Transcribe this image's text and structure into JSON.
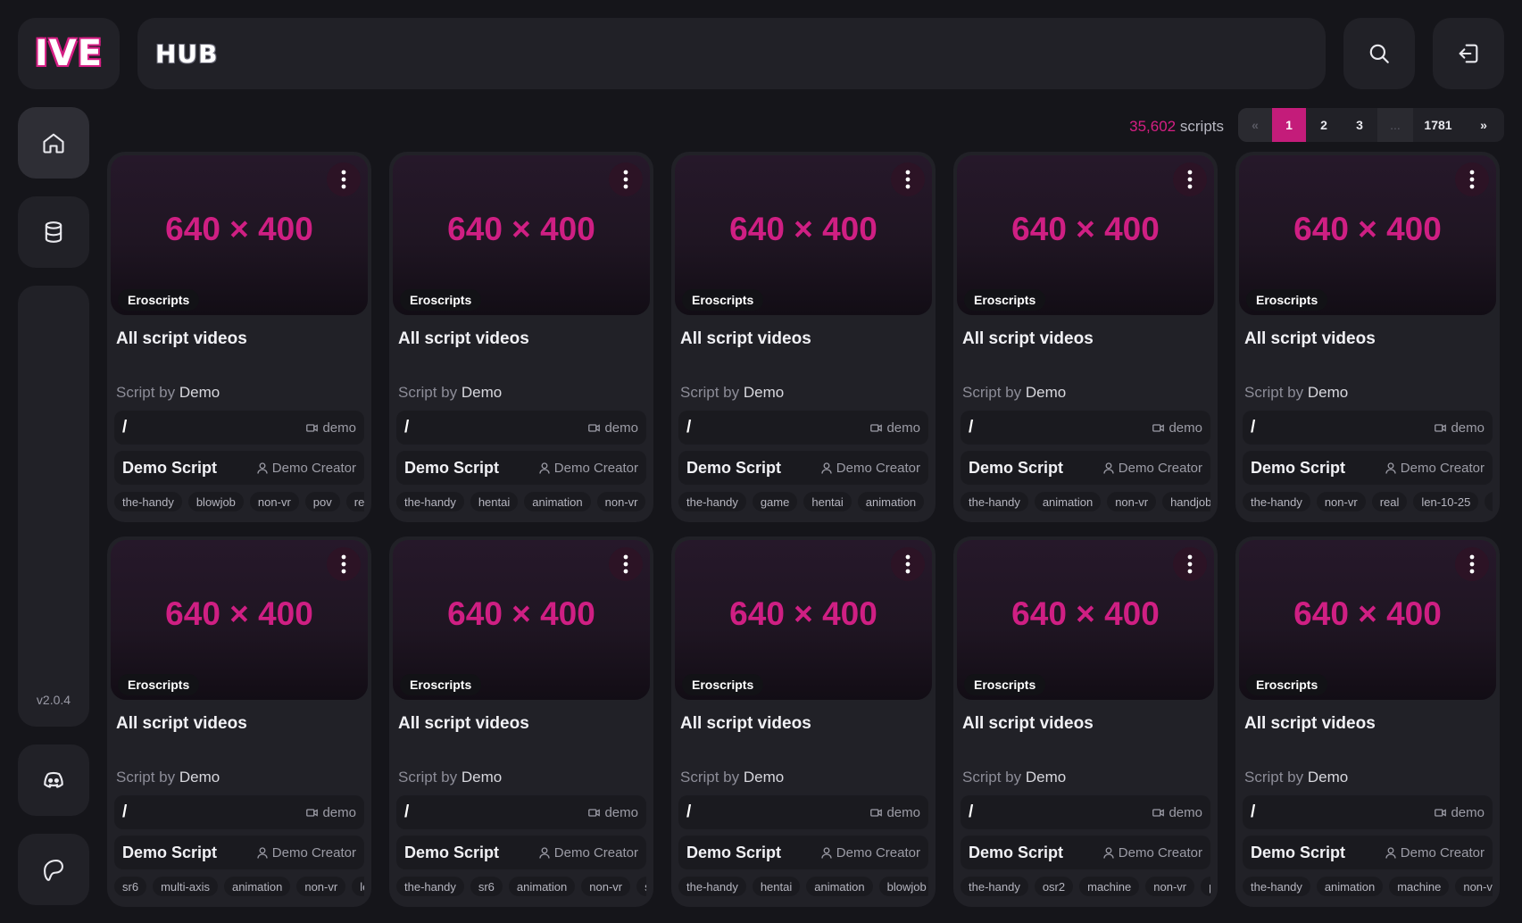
{
  "app": {
    "logo": "IVE",
    "title": "HUB",
    "version": "v2.0.4",
    "accent_color": "#d61f84"
  },
  "header": {
    "search_icon": "search-icon",
    "logout_icon": "logout-icon"
  },
  "sidebar": {
    "items": [
      {
        "name": "home",
        "icon": "home-icon",
        "active": true
      },
      {
        "name": "database",
        "icon": "database-icon",
        "active": false
      },
      {
        "name": "discord",
        "icon": "discord-icon",
        "active": false
      },
      {
        "name": "patreon",
        "icon": "patreon-icon",
        "active": false
      }
    ]
  },
  "results": {
    "count": "35,602",
    "count_label": "scripts"
  },
  "pagination": {
    "prev": "«",
    "pages": [
      "1",
      "2",
      "3"
    ],
    "ellipsis": "...",
    "last": "1781",
    "next": "»",
    "current": "1"
  },
  "cards": [
    {
      "thumb": "640 × 400",
      "source": "Eroscripts",
      "title": "All script videos",
      "script_by": "Script by",
      "author": "Demo",
      "path": "/",
      "video_user": "demo",
      "script_name": "Demo Script",
      "creator": "Demo Creator",
      "tags": [
        "the-handy",
        "blowjob",
        "non-vr",
        "pov",
        "re"
      ]
    },
    {
      "thumb": "640 × 400",
      "source": "Eroscripts",
      "title": "All script videos",
      "script_by": "Script by",
      "author": "Demo",
      "path": "/",
      "video_user": "demo",
      "script_name": "Demo Script",
      "creator": "Demo Creator",
      "tags": [
        "the-handy",
        "hentai",
        "animation",
        "non-vr"
      ]
    },
    {
      "thumb": "640 × 400",
      "source": "Eroscripts",
      "title": "All script videos",
      "script_by": "Script by",
      "author": "Demo",
      "path": "/",
      "video_user": "demo",
      "script_name": "Demo Script",
      "creator": "Demo Creator",
      "tags": [
        "the-handy",
        "game",
        "hentai",
        "animation"
      ]
    },
    {
      "thumb": "640 × 400",
      "source": "Eroscripts",
      "title": "All script videos",
      "script_by": "Script by",
      "author": "Demo",
      "path": "/",
      "video_user": "demo",
      "script_name": "Demo Script",
      "creator": "Demo Creator",
      "tags": [
        "the-handy",
        "animation",
        "non-vr",
        "handjob"
      ]
    },
    {
      "thumb": "640 × 400",
      "source": "Eroscripts",
      "title": "All script videos",
      "script_by": "Script by",
      "author": "Demo",
      "path": "/",
      "video_user": "demo",
      "script_name": "Demo Script",
      "creator": "Demo Creator",
      "tags": [
        "the-handy",
        "non-vr",
        "real",
        "len-10-25",
        "s"
      ]
    },
    {
      "thumb": "640 × 400",
      "source": "Eroscripts",
      "title": "All script videos",
      "script_by": "Script by",
      "author": "Demo",
      "path": "/",
      "video_user": "demo",
      "script_name": "Demo Script",
      "creator": "Demo Creator",
      "tags": [
        "sr6",
        "multi-axis",
        "animation",
        "non-vr",
        "le"
      ]
    },
    {
      "thumb": "640 × 400",
      "source": "Eroscripts",
      "title": "All script videos",
      "script_by": "Script by",
      "author": "Demo",
      "path": "/",
      "video_user": "demo",
      "script_name": "Demo Script",
      "creator": "Demo Creator",
      "tags": [
        "the-handy",
        "sr6",
        "animation",
        "non-vr",
        "s"
      ]
    },
    {
      "thumb": "640 × 400",
      "source": "Eroscripts",
      "title": "All script videos",
      "script_by": "Script by",
      "author": "Demo",
      "path": "/",
      "video_user": "demo",
      "script_name": "Demo Script",
      "creator": "Demo Creator",
      "tags": [
        "the-handy",
        "hentai",
        "animation",
        "blowjob"
      ]
    },
    {
      "thumb": "640 × 400",
      "source": "Eroscripts",
      "title": "All script videos",
      "script_by": "Script by",
      "author": "Demo",
      "path": "/",
      "video_user": "demo",
      "script_name": "Demo Script",
      "creator": "Demo Creator",
      "tags": [
        "the-handy",
        "osr2",
        "machine",
        "non-vr",
        "p"
      ]
    },
    {
      "thumb": "640 × 400",
      "source": "Eroscripts",
      "title": "All script videos",
      "script_by": "Script by",
      "author": "Demo",
      "path": "/",
      "video_user": "demo",
      "script_name": "Demo Script",
      "creator": "Demo Creator",
      "tags": [
        "the-handy",
        "animation",
        "machine",
        "non-vi"
      ]
    }
  ]
}
